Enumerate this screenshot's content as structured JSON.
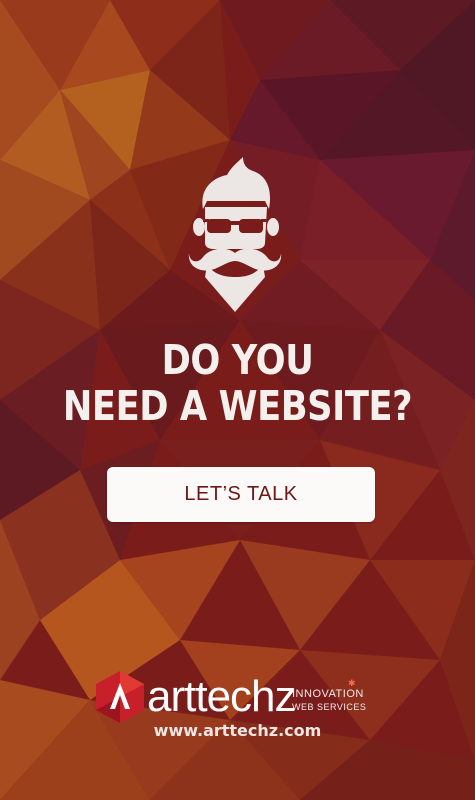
{
  "headline": {
    "line1": "DO YOU",
    "line2": "NEED A WEBSITE?"
  },
  "cta": {
    "label": "LET’S TALK"
  },
  "brand": {
    "name": "arttechz",
    "tagline_top": "INNOVATION",
    "tagline_bottom": "WEB SERVICES",
    "url": "www.arttechz.com"
  },
  "icons": {
    "hero": "bearded-man-with-sunglasses-icon",
    "logo": "arttechz-logo-mark"
  },
  "colors": {
    "background": "#7a1d1a",
    "text": "#f4f0ee",
    "button_bg": "#fbfaf9",
    "button_text": "#6c1716",
    "logo_red": "#c8202a"
  }
}
